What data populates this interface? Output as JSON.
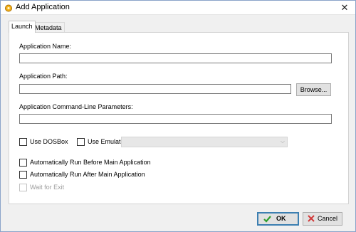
{
  "window": {
    "title": "Add Application",
    "close_glyph": "✕"
  },
  "tabs": [
    {
      "label": "Launch",
      "active": true
    },
    {
      "label": "Metadata",
      "active": false
    }
  ],
  "fields": {
    "app_name_label": "Application Name:",
    "app_name_value": "",
    "app_path_label": "Application Path:",
    "app_path_value": "",
    "browse_label": "Browse...",
    "cmdline_label": "Application Command-Line Parameters:",
    "cmdline_value": ""
  },
  "options": {
    "use_dosbox_label": "Use DOSBox",
    "use_emulator_label": "Use Emulator:",
    "emulator_selected": "",
    "run_before_label": "Automatically Run Before Main Application",
    "run_after_label": "Automatically Run After Main Application",
    "wait_for_exit_label": "Wait for Exit"
  },
  "buttons": {
    "ok_label": "OK",
    "ok_icon": "check-icon",
    "cancel_label": "Cancel",
    "cancel_icon": "x-icon"
  },
  "colors": {
    "ok_check": "#2e9e2e",
    "cancel_x": "#d13a3a",
    "default_button_border": "#3c7fb1"
  }
}
